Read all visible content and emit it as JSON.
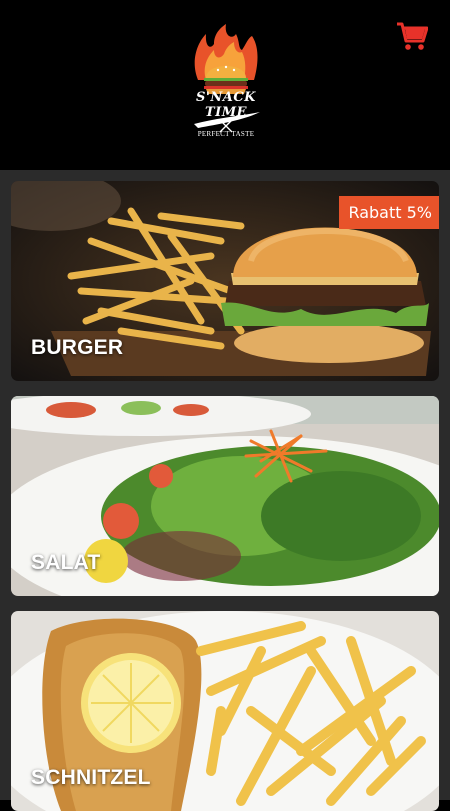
{
  "brand": {
    "name": "S'NACK TIME",
    "tagline": "PERFECT TASTE"
  },
  "header": {
    "cart_icon": "shopping-cart-icon",
    "cart_color": "#e8322a"
  },
  "categories": [
    {
      "label": "BURGER",
      "badge": "Rabatt 5%"
    },
    {
      "label": "SALAT"
    },
    {
      "label": "SCHNITZEL"
    }
  ],
  "colors": {
    "badge": "#e8532a",
    "background": "#2b2b2b",
    "header": "#000000"
  }
}
